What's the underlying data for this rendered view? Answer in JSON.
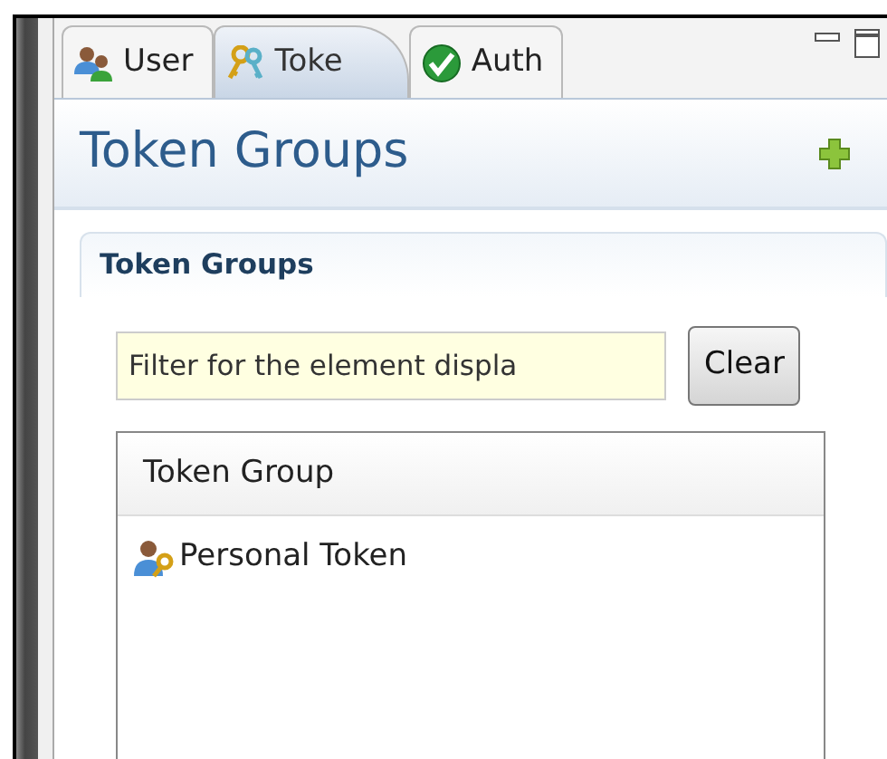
{
  "tabs": [
    {
      "label": "User",
      "kind": "users",
      "selected": false
    },
    {
      "label": "Toke",
      "kind": "keys",
      "selected": true
    },
    {
      "label": "Auth",
      "kind": "check",
      "selected": false
    }
  ],
  "form": {
    "title": "Token Groups"
  },
  "section": {
    "title": "Token Groups"
  },
  "filter": {
    "placeholder": "Filter for the element displa",
    "button": "Clear"
  },
  "table": {
    "columns": [
      "Token Group"
    ],
    "rows": [
      {
        "name": "Personal Token"
      }
    ]
  }
}
